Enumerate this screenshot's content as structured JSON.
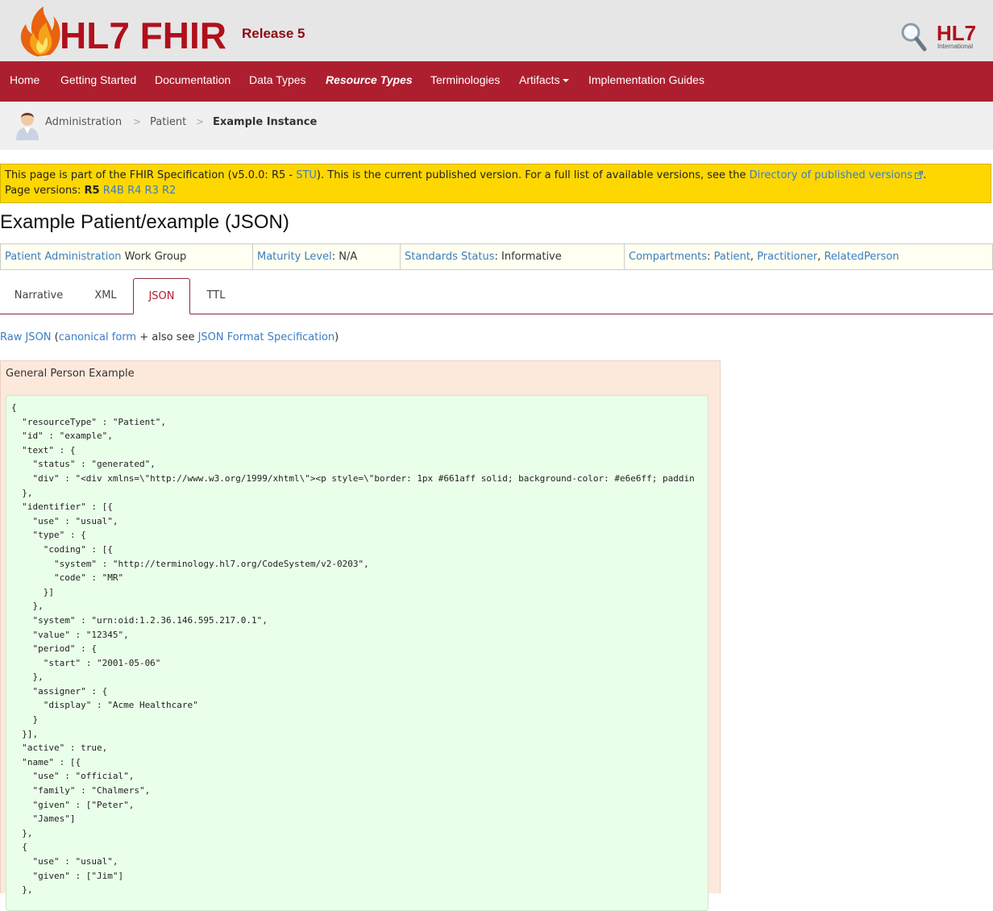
{
  "header": {
    "logo_text": "HL7 FHIR",
    "release_label": "Release 5",
    "org_logo_text": "HL7",
    "org_logo_subtext": "International"
  },
  "nav": {
    "items": [
      {
        "label": "Home"
      },
      {
        "label": "Getting Started"
      },
      {
        "label": "Documentation"
      },
      {
        "label": "Data Types"
      },
      {
        "label": "Resource Types"
      },
      {
        "label": "Terminologies"
      },
      {
        "label": "Artifacts"
      },
      {
        "label": "Implementation Guides"
      }
    ],
    "active": "Resource Types"
  },
  "breadcrumb": {
    "items": [
      "Administration",
      "Patient",
      "Example Instance"
    ],
    "separator": ">"
  },
  "banner": {
    "text_before": "This page is part of the FHIR Specification (v5.0.0: R5 - ",
    "stu_link": "STU",
    "text_after": "). This is the current published version. For a full list of available versions, see the ",
    "directory_link": "Directory of published versions",
    "period": ".",
    "versions_label": "Page versions:",
    "current_version": "R5",
    "other_versions": [
      "R4B",
      "R4",
      "R3",
      "R2"
    ]
  },
  "page_title": "Example Patient/example (JSON)",
  "info": {
    "workgroup_link": "Patient Administration",
    "workgroup_suffix": " Work Group",
    "maturity_label": "Maturity Level",
    "maturity_value": ": N/A",
    "status_label": "Standards Status",
    "status_value": ": Informative",
    "compartments_label": "Compartments",
    "compartments_sep": ": ",
    "compartments": [
      "Patient",
      "Practitioner",
      "RelatedPerson"
    ]
  },
  "tabs": {
    "items": [
      "Narrative",
      "XML",
      "JSON",
      "TTL"
    ],
    "active": "JSON"
  },
  "raw_line": {
    "raw_json": "Raw JSON",
    "open_paren": " (",
    "canonical": "canonical form",
    "also_see": " + also see ",
    "format_spec": "JSON Format Specification",
    "close_paren": ")"
  },
  "example": {
    "title": "General Person Example",
    "code": "{\n  \"resourceType\" : \"Patient\",\n  \"id\" : \"example\",\n  \"text\" : {\n    \"status\" : \"generated\",\n    \"div\" : \"<div xmlns=\\\"http://www.w3.org/1999/xhtml\\\"><p style=\\\"border: 1px #661aff solid; background-color: #e6e6ff; paddin\n  },\n  \"identifier\" : [{\n    \"use\" : \"usual\",\n    \"type\" : {\n      \"coding\" : [{\n        \"system\" : \"http://terminology.hl7.org/CodeSystem/v2-0203\",\n        \"code\" : \"MR\"\n      }]\n    },\n    \"system\" : \"urn:oid:1.2.36.146.595.217.0.1\",\n    \"value\" : \"12345\",\n    \"period\" : {\n      \"start\" : \"2001-05-06\"\n    },\n    \"assigner\" : {\n      \"display\" : \"Acme Healthcare\"\n    }\n  }],\n  \"active\" : true,\n  \"name\" : [{\n    \"use\" : \"official\",\n    \"family\" : \"Chalmers\",\n    \"given\" : [\"Peter\",\n    \"James\"]\n  },\n  {\n    \"use\" : \"usual\",\n    \"given\" : [\"Jim\"]\n  },"
  },
  "colors": {
    "nav_bg": "#ad1f2f",
    "banner_bg": "#fed700",
    "link": "#3b7dc2",
    "panel_bg": "#fde9dc",
    "code_bg": "#eaffea"
  }
}
